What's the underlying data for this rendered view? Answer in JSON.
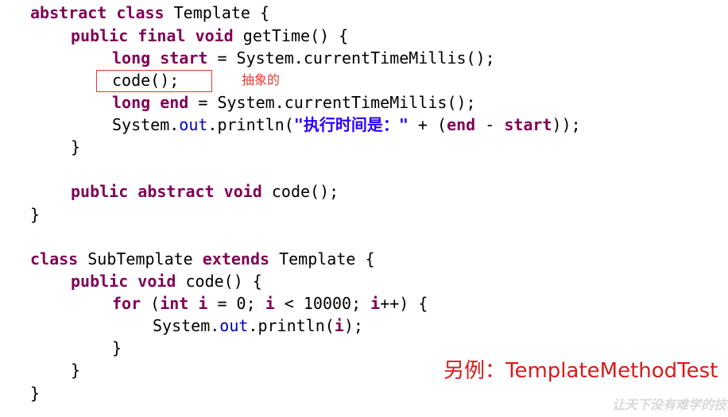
{
  "code": {
    "l1": {
      "t1": "abstract",
      "t2": " ",
      "t3": "class",
      "t4": " Template {"
    },
    "l2": {
      "t1": "public",
      "t2": " ",
      "t3": "final",
      "t4": " ",
      "t5": "void",
      "t6": " getTime() {"
    },
    "l3": {
      "t1": "long",
      "t2": " ",
      "t3": "start",
      "t4": " = System.currentTimeMillis();"
    },
    "l4": {
      "t1": "code();"
    },
    "l5": {
      "t1": "long",
      "t2": " ",
      "t3": "end",
      "t4": " = System.currentTimeMillis();"
    },
    "l6": {
      "t1": "System.",
      "t2": "out",
      "t3": ".println(",
      "t4": "\"执行时间是：\"",
      "t5": " + (",
      "t6": "end",
      "t7": " - ",
      "t8": "start",
      "t9": "));"
    },
    "l7": {
      "t1": "}"
    },
    "l9": {
      "t1": "public",
      "t2": " ",
      "t3": "abstract",
      "t4": " ",
      "t5": "void",
      "t6": " code();"
    },
    "l10": {
      "t1": "}"
    },
    "l12": {
      "t1": "class",
      "t2": " SubTemplate ",
      "t3": "extends",
      "t4": " Template {"
    },
    "l13": {
      "t1": "public",
      "t2": " ",
      "t3": "void",
      "t4": " code() {"
    },
    "l14": {
      "t1": "for",
      "t2": " (",
      "t3": "int",
      "t4": " ",
      "t5": "i",
      "t6": " = 0; ",
      "t7": "i",
      "t8": " < 10000; ",
      "t9": "i",
      "t10": "++) {"
    },
    "l15": {
      "t1": "System.",
      "t2": "out",
      "t3": ".println(",
      "t4": "i",
      "t5": ");"
    },
    "l16": {
      "t1": "}"
    },
    "l17": {
      "t1": "}"
    },
    "l18": {
      "t1": "}"
    }
  },
  "annotation": {
    "text": "抽象的"
  },
  "caption": {
    "text": "另例：TemplateMethodTest"
  },
  "watermark": {
    "text": "让天下没有难学的技术"
  },
  "colors": {
    "keyword": "#7f0055",
    "field": "#0000c0",
    "string": "#2a00ff",
    "annotation": "#e53935",
    "caption": "#d81b1b"
  }
}
